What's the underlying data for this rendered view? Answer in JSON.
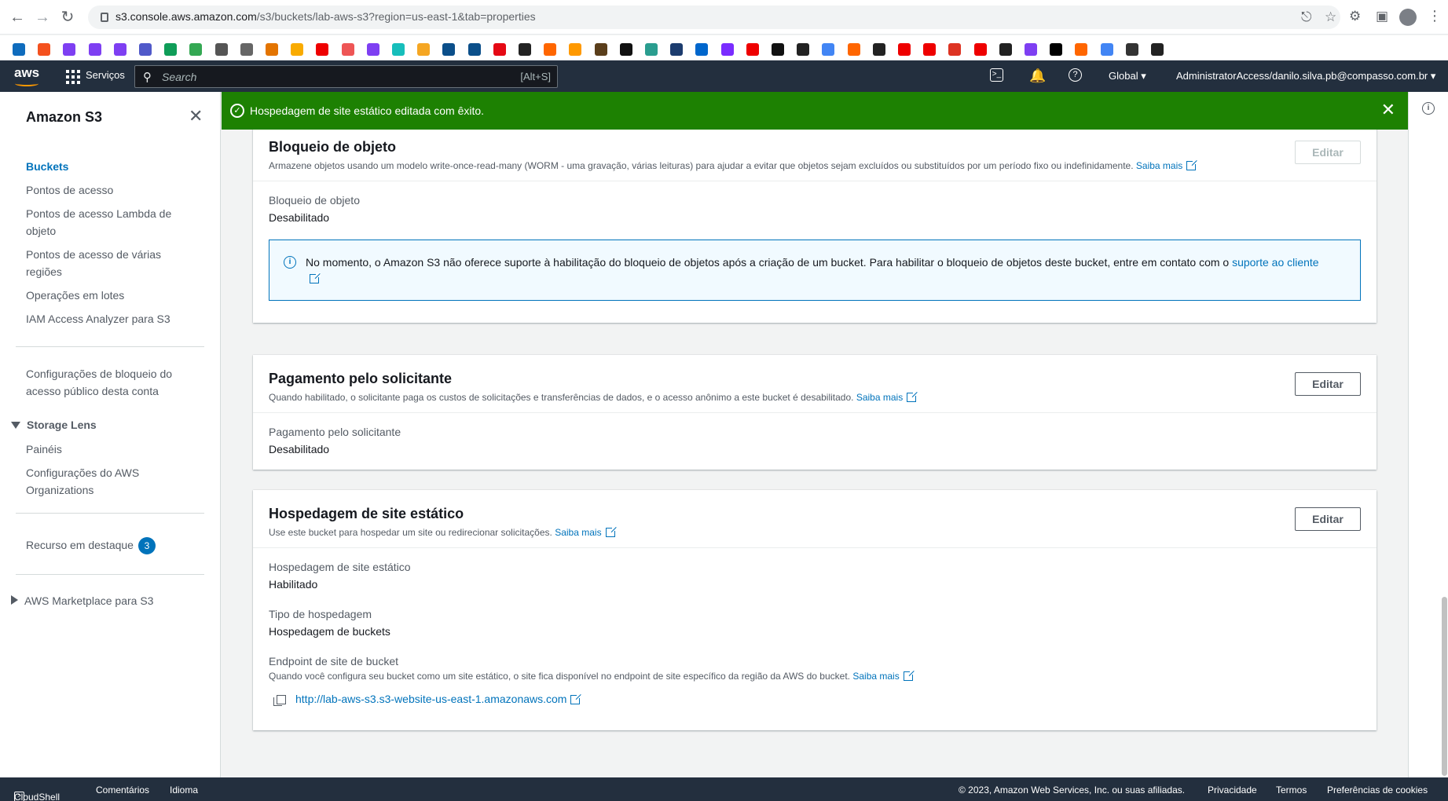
{
  "browser": {
    "url_host": "s3.console.aws.amazon.com",
    "url_path": "/s3/buckets/lab-aws-s3?region=us-east-1&tab=properties",
    "back_icon": "arrow-left",
    "forward_icon": "arrow-right",
    "reload_icon": "reload",
    "bookmark_count": 46
  },
  "aws_nav": {
    "logo": "aws",
    "services_label": "Serviços",
    "search_placeholder": "Search",
    "search_shortcut": "[Alt+S]",
    "region": "Global",
    "account": "AdministratorAccess/danilo.silva.pb@compasso.com.br"
  },
  "sidebar": {
    "title": "Amazon S3",
    "items": [
      {
        "label": "Buckets",
        "active": true
      },
      {
        "label": "Pontos de acesso"
      },
      {
        "label": "Pontos de acesso Lambda de objeto"
      },
      {
        "label": "Pontos de acesso de várias regiões"
      },
      {
        "label": "Operações em lotes"
      },
      {
        "label": "IAM Access Analyzer para S3"
      }
    ],
    "block_public_label": "Configurações de bloqueio do acesso público desta conta",
    "storage_lens": {
      "label": "Storage Lens",
      "items": [
        "Painéis",
        "Configurações do AWS Organizations"
      ]
    },
    "featured_label": "Recurso em destaque",
    "featured_count": "3",
    "marketplace_label": "AWS Marketplace para S3"
  },
  "flash": {
    "message": "Hospedagem de site estático editada com êxito.",
    "color": "#1d8102"
  },
  "panels": {
    "object_lock": {
      "title": "Bloqueio de objeto",
      "description": "Armazene objetos usando um modelo write-once-read-many (WORM - uma gravação, várias leituras) para ajudar a evitar que objetos sejam excluídos ou substituídos por um período fixo ou indefinidamente.",
      "learn_more": "Saiba mais",
      "edit_label": "Editar",
      "key": "Bloqueio de objeto",
      "value": "Desabilitado",
      "alert_text": "No momento, o Amazon S3 não oferece suporte à habilitação do bloqueio de objetos após a criação de um bucket. Para habilitar o bloqueio de objetos deste bucket, entre em contato com o",
      "alert_link": "suporte ao cliente"
    },
    "requester_pays": {
      "title": "Pagamento pelo solicitante",
      "description": "Quando habilitado, o solicitante paga os custos de solicitações e transferências de dados, e o acesso anônimo a este bucket é desabilitado.",
      "learn_more": "Saiba mais",
      "edit_label": "Editar",
      "key": "Pagamento pelo solicitante",
      "value": "Desabilitado"
    },
    "static_hosting": {
      "title": "Hospedagem de site estático",
      "description": "Use este bucket para hospedar um site ou redirecionar solicitações.",
      "learn_more": "Saiba mais",
      "edit_label": "Editar",
      "key1": "Hospedagem de site estático",
      "value1": "Habilitado",
      "key2": "Tipo de hospedagem",
      "value2": "Hospedagem de buckets",
      "key3": "Endpoint de site de bucket",
      "endpoint_desc": "Quando você configura seu bucket como um site estático, o site fica disponível no endpoint de site específico da região da AWS do bucket.",
      "endpoint_learn_more": "Saiba mais",
      "endpoint_url": "http://lab-aws-s3.s3-website-us-east-1.amazonaws.com"
    }
  },
  "footer": {
    "cloudshell": "CloudShell",
    "feedback": "Comentários",
    "language": "Idioma",
    "copyright": "© 2023, Amazon Web Services, Inc. ou suas afiliadas.",
    "privacy": "Privacidade",
    "terms": "Termos",
    "cookies": "Preferências de cookies"
  }
}
